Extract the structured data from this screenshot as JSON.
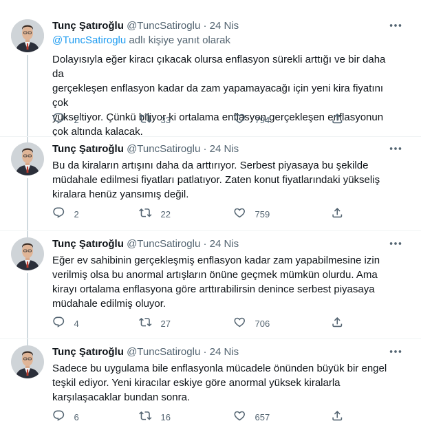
{
  "tweets": [
    {
      "author": {
        "name": "Tunç Şatıroğlu",
        "handle": "@TuncSatiroglu",
        "avatar": "avatar-photo"
      },
      "date": "24 Nis",
      "reply_to": {
        "mention": "@TuncSatiroglu",
        "suffix": " adlı kişiye yanıt olarak"
      },
      "lines": [
        "Dolayısıyla eğer kiracı çıkacak olursa enflasyon sürekli arttığı ve bir daha da",
        "gerçekleşen enflasyon kadar da zam yapamayacağı için yeni kira fiyatını çok",
        "yükseltiyor. Çünkü biliyor ki ortalama enflasyon gerçekleşen enflasyonun",
        "çok altında kalacak."
      ],
      "stats": {
        "replies": "2",
        "retweets": "33",
        "likes": "794"
      }
    },
    {
      "author": {
        "name": "Tunç Şatıroğlu",
        "handle": "@TuncSatiroglu",
        "avatar": "avatar-photo"
      },
      "date": "24 Nis",
      "lines": [
        "Bu da kiraların artışını daha da arttırıyor. Serbest piyasaya bu şekilde",
        "müdahale edilmesi fiyatları patlatıyor. Zaten konut fiyatlarındaki yükseliş",
        "kiralara henüz yansımış değil."
      ],
      "stats": {
        "replies": "2",
        "retweets": "22",
        "likes": "759"
      }
    },
    {
      "author": {
        "name": "Tunç Şatıroğlu",
        "handle": "@TuncSatiroglu",
        "avatar": "avatar-photo"
      },
      "date": "24 Nis",
      "lines": [
        "Eğer ev sahibinin gerçekleşmiş enflasyon kadar zam yapabilmesine izin",
        "verilmiş olsa bu anormal artışların önüne geçmek mümkün olurdu. Ama",
        "kirayı ortalama enflasyona göre arttırabilirsin denince serbest piyasaya",
        "müdahale edilmiş oluyor."
      ],
      "stats": {
        "replies": "4",
        "retweets": "27",
        "likes": "706"
      }
    },
    {
      "author": {
        "name": "Tunç Şatıroğlu",
        "handle": "@TuncSatiroglu",
        "avatar": "avatar-photo"
      },
      "date": "24 Nis",
      "lines": [
        "Sadece bu uygulama bile enflasyonla mücadele önünden büyük bir engel",
        "teşkil ediyor. Yeni kiracılar eskiye göre anormal yüksek kiralarla",
        "karşılaşacaklar bundan sonra."
      ],
      "stats": {
        "replies": "6",
        "retweets": "16",
        "likes": "657"
      }
    }
  ],
  "separator": "·",
  "icons": {
    "reply": "reply-icon",
    "retweet": "retweet-icon",
    "like": "heart-icon",
    "share": "share-icon",
    "more": "more-icon"
  },
  "colors": {
    "accent": "#1d9bf0",
    "muted": "#536471",
    "text": "#0f1419"
  }
}
